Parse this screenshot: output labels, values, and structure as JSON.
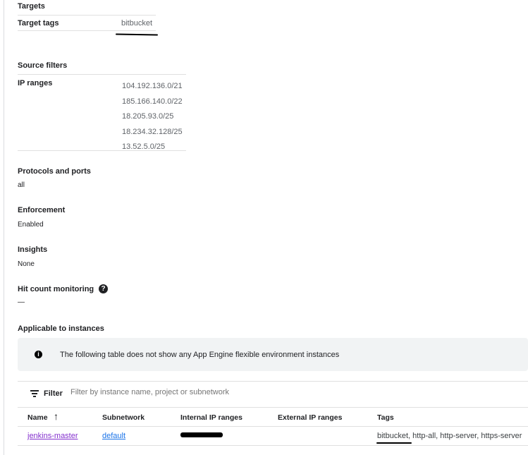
{
  "targets": {
    "heading": "Targets",
    "label": "Target tags",
    "value": "bitbucket"
  },
  "source_filters": {
    "heading": "Source filters",
    "label": "IP ranges",
    "ranges": [
      "104.192.136.0/21",
      "185.166.140.0/22",
      "18.205.93.0/25",
      "18.234.32.128/25",
      "13.52.5.0/25"
    ]
  },
  "protocols": {
    "heading": "Protocols and ports",
    "value": "all"
  },
  "enforcement": {
    "heading": "Enforcement",
    "value": "Enabled"
  },
  "insights": {
    "heading": "Insights",
    "value": "None"
  },
  "hit_count": {
    "heading": "Hit count monitoring",
    "value": "—"
  },
  "applicable": {
    "heading": "Applicable to instances",
    "info": "The following table does not show any App Engine flexible environment instances"
  },
  "filter": {
    "label": "Filter",
    "placeholder": "Filter by instance name, project or subnetwork"
  },
  "table": {
    "headers": [
      "Name",
      "Subnetwork",
      "Internal IP ranges",
      "External IP ranges",
      "Tags"
    ],
    "rows": [
      {
        "name": "jenkins-master",
        "subnetwork": "default",
        "internal_ip": "",
        "external_ip": "",
        "tags_first": "bitbucket",
        "tags_rest": ", http-all, http-server, https-server"
      }
    ]
  }
}
